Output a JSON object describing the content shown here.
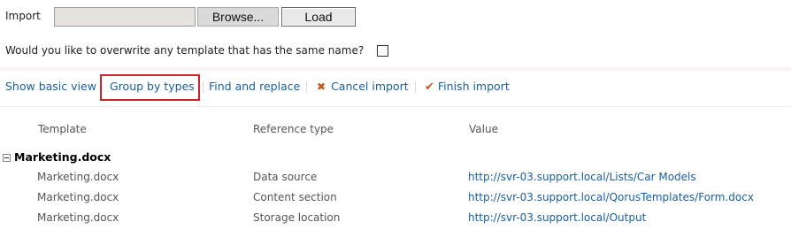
{
  "import": {
    "label": "Import",
    "browse_label": "Browse...",
    "load_label": "Load"
  },
  "overwrite": {
    "question": "Would you like to overwrite any template that has the same name?",
    "checked": false
  },
  "toolbar": {
    "show_basic_view": "Show basic view",
    "group_by_types": "Group by types",
    "find_and_replace": "Find and replace",
    "cancel_import": "Cancel import",
    "finish_import": "Finish import",
    "accent_color": "#1a5fa0",
    "highlight_color": "#d0202e",
    "icon_color": "#c8561a"
  },
  "table": {
    "headers": {
      "template": "Template",
      "reference_type": "Reference type",
      "value": "Value"
    },
    "group": {
      "name": "Marketing.docx",
      "expanded": true
    },
    "rows": [
      {
        "template": "Marketing.docx",
        "reference_type": "Data source",
        "value": "http://svr-03.support.local/Lists/Car Models"
      },
      {
        "template": "Marketing.docx",
        "reference_type": "Content section",
        "value": "http://svr-03.support.local/QorusTemplates/Form.docx"
      },
      {
        "template": "Marketing.docx",
        "reference_type": "Storage location",
        "value": "http://svr-03.support.local/Output"
      }
    ]
  }
}
